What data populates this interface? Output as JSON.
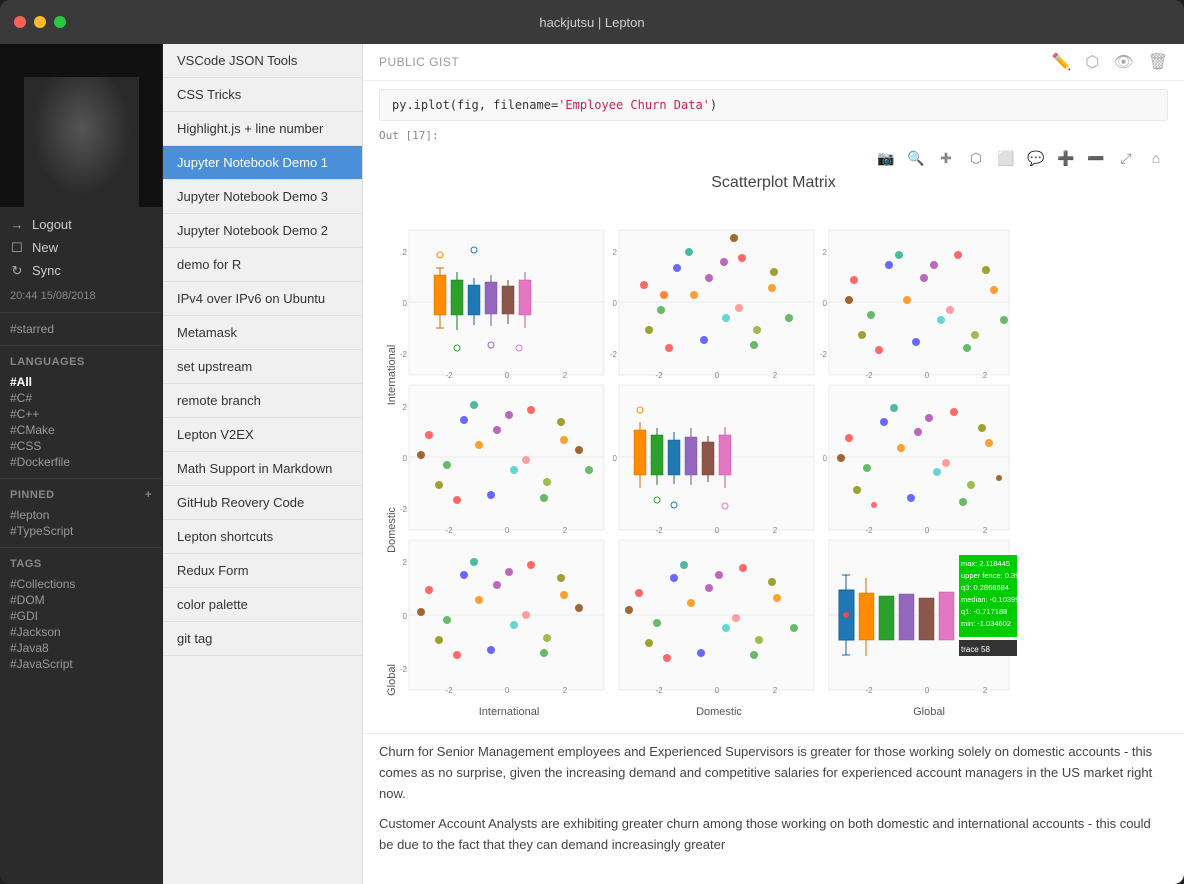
{
  "window": {
    "title": "hackjutsu | Lepton"
  },
  "titlebar": {
    "buttons": {
      "close": "close",
      "minimize": "minimize",
      "maximize": "maximize"
    }
  },
  "sidebar": {
    "actions": [
      {
        "id": "logout",
        "label": "Logout",
        "icon": "→"
      },
      {
        "id": "new",
        "label": "New",
        "icon": "□"
      },
      {
        "id": "sync",
        "label": "Sync",
        "icon": "↻"
      }
    ],
    "timestamp": "20:44 15/08/2018",
    "starred_tag": "#starred",
    "languages_section": {
      "header": "LANGUAGES",
      "items": [
        {
          "label": "#All",
          "active": true
        },
        {
          "label": "#C#"
        },
        {
          "label": "#C++"
        },
        {
          "label": "#CMake"
        },
        {
          "label": "#CSS"
        },
        {
          "label": "#Dockerfile"
        }
      ]
    },
    "pinned_section": {
      "header": "PINNED",
      "plus_label": "+",
      "items": [
        {
          "label": "#lepton"
        },
        {
          "label": "#TypeScript"
        }
      ]
    },
    "tags_section": {
      "header": "TAGS",
      "items": [
        {
          "label": "#Collections"
        },
        {
          "label": "#DOM"
        },
        {
          "label": "#GDI"
        },
        {
          "label": "#Jackson"
        },
        {
          "label": "#Java8"
        },
        {
          "label": "#JavaScript"
        }
      ]
    }
  },
  "snippet_list": {
    "items": [
      {
        "label": "VSCode JSON Tools"
      },
      {
        "label": "CSS Tricks"
      },
      {
        "label": "Highlight.js + line number"
      },
      {
        "label": "Jupyter Notebook Demo 1",
        "active": true
      },
      {
        "label": "Jupyter Notebook Demo 3"
      },
      {
        "label": "Jupyter Notebook Demo 2"
      },
      {
        "label": "demo for R"
      },
      {
        "label": "IPv4 over IPv6 on Ubuntu"
      },
      {
        "label": "Metamask"
      },
      {
        "label": "set upstream"
      },
      {
        "label": "remote branch"
      },
      {
        "label": "Lepton V2EX"
      },
      {
        "label": "Math Support in Markdown"
      },
      {
        "label": "GitHub Reovery Code"
      },
      {
        "label": "Lepton shortcuts"
      },
      {
        "label": "Redux Form"
      },
      {
        "label": "color palette"
      },
      {
        "label": "git tag"
      }
    ]
  },
  "content": {
    "header_label": "PUBLIC GIST",
    "header_icons": [
      "pencil",
      "external-link",
      "eye",
      "trash"
    ],
    "code_line": "py.iplot(fig, filename=",
    "code_string": "'Employee Churn Data'",
    "code_end": ")",
    "output_label": "Out [17]:",
    "plot_title": "Scatterplot Matrix",
    "plot_toolbar_icons": [
      "camera",
      "magnify",
      "plus",
      "lasso",
      "rect-select",
      "comment",
      "zoom-in",
      "zoom-out",
      "autoscale",
      "home"
    ],
    "tooltip": {
      "max": "max: 2.118445",
      "upper_fence": "upper fence: 0.39",
      "q3": "q3: 0.2868684",
      "median": "median: -0.10399",
      "q1": "q1: -0.717188",
      "min": "min: -1.034602",
      "trace": "trace 58"
    },
    "axis_labels": {
      "row1": "International",
      "row2": "Domestic",
      "row3": "Global",
      "col1": "International",
      "col2": "Domestic",
      "col3": "Global"
    },
    "paragraphs": [
      "Churn for Senior Management employees and Experienced Supervisors is greater for those working solely on domestic accounts - this comes as no surprise, given the increasing demand and competitive salaries for experienced account managers in the US market right now.",
      "Customer Account Analysts are exhibiting greater churn among those working on both domestic and international accounts - this could be due to the fact that they can demand increasingly greater"
    ]
  }
}
